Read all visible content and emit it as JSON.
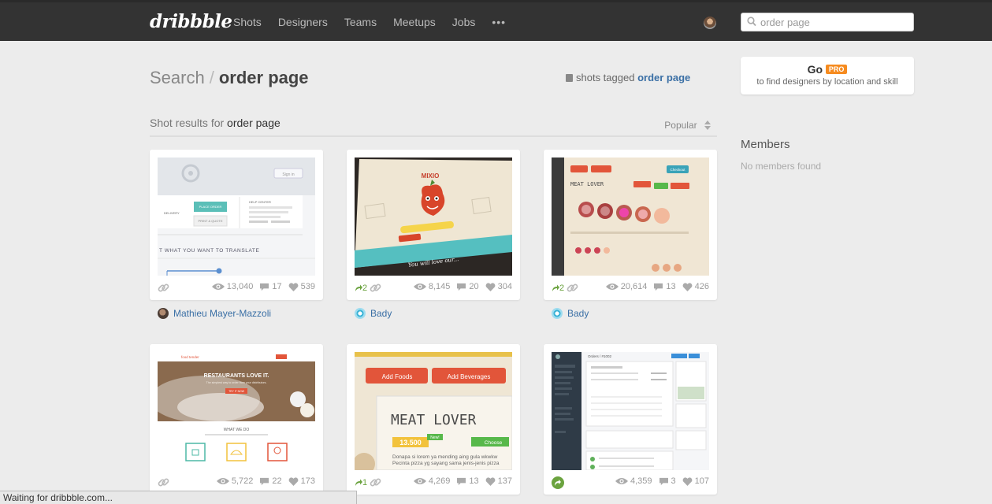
{
  "topbar": {
    "logo": "dribbble",
    "nav": [
      "Shots",
      "Designers",
      "Teams",
      "Meetups",
      "Jobs"
    ],
    "more": "•••",
    "search_value": "order page"
  },
  "heading": {
    "search_label": "Search",
    "separator": "/",
    "query": "order page",
    "tagged_prefix": "shots tagged",
    "tagged_query": "order page"
  },
  "gopro": {
    "go": "Go",
    "badge": "PRO",
    "sub": "to find designers by location and skill"
  },
  "results": {
    "label": "Shot results for",
    "query": "order page",
    "sort": "Popular"
  },
  "members": {
    "title": "Members",
    "empty": "No members found"
  },
  "shots": [
    {
      "rebounds": "",
      "views": "13,040",
      "comments": "17",
      "likes": "539",
      "author": "Mathieu Mayer-Mazzoli"
    },
    {
      "rebounds": "2",
      "views": "8,145",
      "comments": "20",
      "likes": "304",
      "author": "Bady"
    },
    {
      "rebounds": "2",
      "views": "20,614",
      "comments": "13",
      "likes": "426",
      "author": "Bady"
    },
    {
      "rebounds": "",
      "views": "5,722",
      "comments": "22",
      "likes": "173",
      "author": ""
    },
    {
      "rebounds": "1",
      "views": "4,269",
      "comments": "13",
      "likes": "137",
      "author": ""
    },
    {
      "rebounds": "",
      "views": "4,359",
      "comments": "3",
      "likes": "107",
      "author": ""
    }
  ],
  "thumbs": {
    "t1": {
      "btn1": "PLACE ORDER",
      "btn2": "PRINT & QUOTE",
      "help": "HELP CENTER",
      "heading": "T WHAT YOU WANT TO TRANSLATE",
      "signin": "Sign in",
      "delivery": "DELIVERY"
    },
    "t2": {
      "logo": "MIXIO"
    },
    "t3": {
      "title": "MEAT LOVER",
      "btn1": "Add Foods",
      "btn2": "Add Beverages",
      "checkout": "Checkout"
    },
    "t4": {
      "brand": "food tender",
      "headline": "RESTAURANTS LOVE IT.",
      "sub": "The simplest way to order from your distributors.",
      "what": "WHAT WE DO",
      "cta": "TRY IT NOW"
    },
    "t5": {
      "btn1": "Add Foods",
      "btn2": "Add Beverages",
      "title": "MEAT LOVER",
      "price": "13.500",
      "new": "New!",
      "choose": "Choose",
      "lorem": "Donapa si lorem ya mending aing gula wkwkw Pecinta pizza yg sayang sama jenis-jenis pizza"
    },
    "t6": {
      "crumb": "Orders / #1002"
    }
  },
  "status": "Waiting for dribbble.com..."
}
